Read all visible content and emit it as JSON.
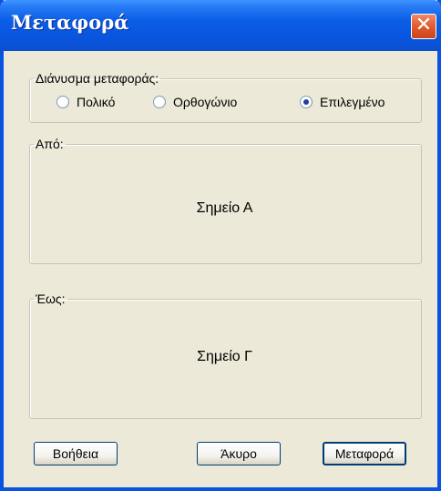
{
  "window": {
    "title": "Μεταφορά",
    "close_label": "✕"
  },
  "vector_group": {
    "legend": "Διάνυσμα μεταφοράς:",
    "options": [
      {
        "label": "Πολικό",
        "checked": false
      },
      {
        "label": "Ορθογώνιο",
        "checked": false
      },
      {
        "label": "Επιλεγμένο",
        "checked": true
      }
    ]
  },
  "from_group": {
    "legend": "Από:",
    "value": "Σημείο Α"
  },
  "to_group": {
    "legend": "Έως:",
    "value": "Σημείο Γ"
  },
  "buttons": {
    "help": "Βοήθεια",
    "cancel": "Άκυρο",
    "ok": "Μεταφορά"
  }
}
